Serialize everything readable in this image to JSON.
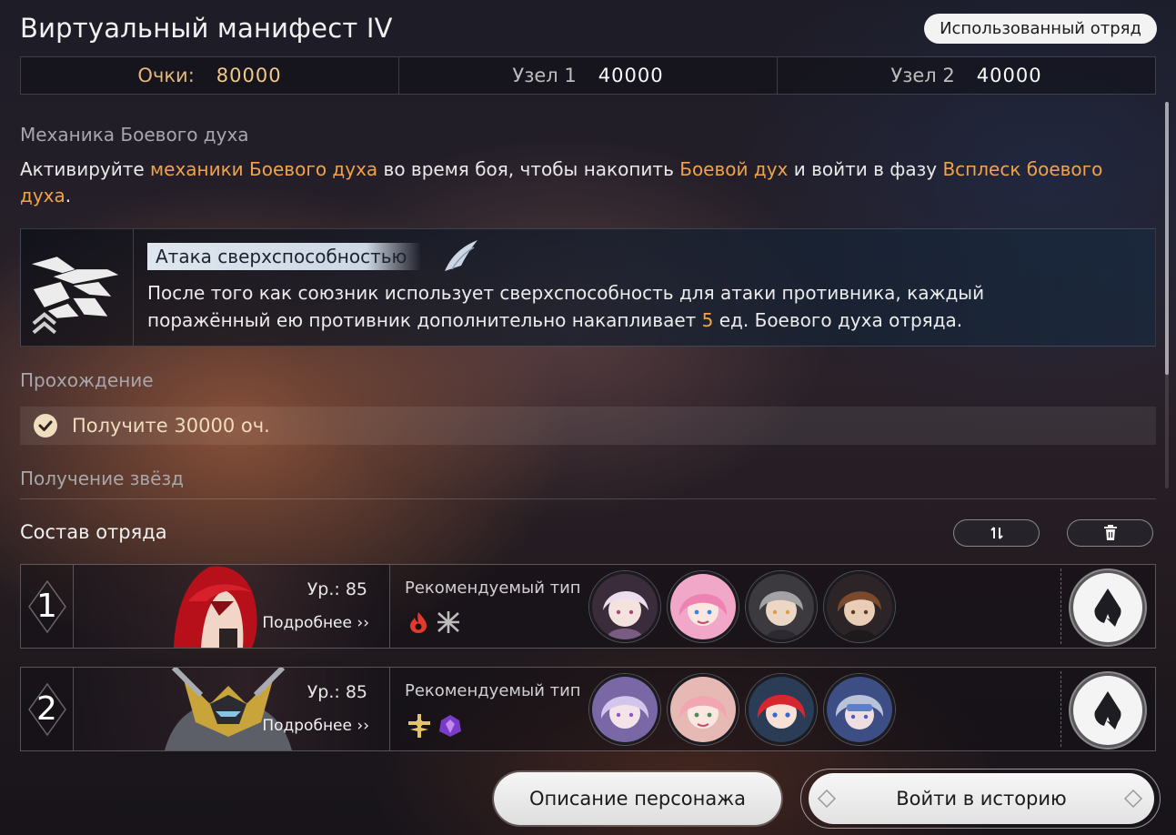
{
  "header": {
    "title": "Виртуальный манифест IV",
    "used_squad_button": "Использованный отряд"
  },
  "scores": [
    {
      "label": "Очки:",
      "value": "80000",
      "highlight": true
    },
    {
      "label": "Узел 1",
      "value": "40000",
      "highlight": false
    },
    {
      "label": "Узел 2",
      "value": "40000",
      "highlight": false
    }
  ],
  "mechanic": {
    "section_label": "Механика Боевого духа",
    "desc_parts": [
      {
        "text": "Активируйте ",
        "hl": false
      },
      {
        "text": "механики Боевого духа",
        "hl": true
      },
      {
        "text": " во время боя, чтобы накопить ",
        "hl": false
      },
      {
        "text": "Боевой дух",
        "hl": true
      },
      {
        "text": " и войти в фазу ",
        "hl": false
      },
      {
        "text": "Всплеск боевого духа",
        "hl": true
      },
      {
        "text": ".",
        "hl": false
      }
    ],
    "card": {
      "name": "Атака сверхспособностью",
      "text_before": "После того как союзник использует сверхспособность для атаки противника, каждый поражённый ею противник дополнительно накапливает ",
      "text_number": "5",
      "text_after": " ед. Боевого духа отряда."
    }
  },
  "passage": {
    "section_label": "Прохождение",
    "requirement": "Получите 30000 оч."
  },
  "stars": {
    "section_label": "Получение звёзд"
  },
  "squad": {
    "title": "Состав отряда",
    "swap_icon": "swap-icon",
    "delete_icon": "trash-icon",
    "teams": [
      {
        "number": "1",
        "level": "Ур.: 85",
        "more": "Подробнее",
        "rec_label": "Рекомендуемый тип",
        "rec_icons": [
          "fire-element-icon",
          "destruction-path-icon"
        ],
        "path_icon": "quantum-element-icon"
      },
      {
        "number": "2",
        "level": "Ур.: 85",
        "more": "Подробнее",
        "rec_label": "Рекомендуемый тип",
        "rec_icons": [
          "erudition-path-icon",
          "quantum-element-icon"
        ],
        "path_icon": "quantum-element-icon"
      }
    ]
  },
  "footer": {
    "character_desc_button": "Описание персонажа",
    "enter_story_button": "Войти в историю"
  },
  "colors": {
    "highlight": "#f2a24a",
    "gold": "#f0c98a"
  }
}
